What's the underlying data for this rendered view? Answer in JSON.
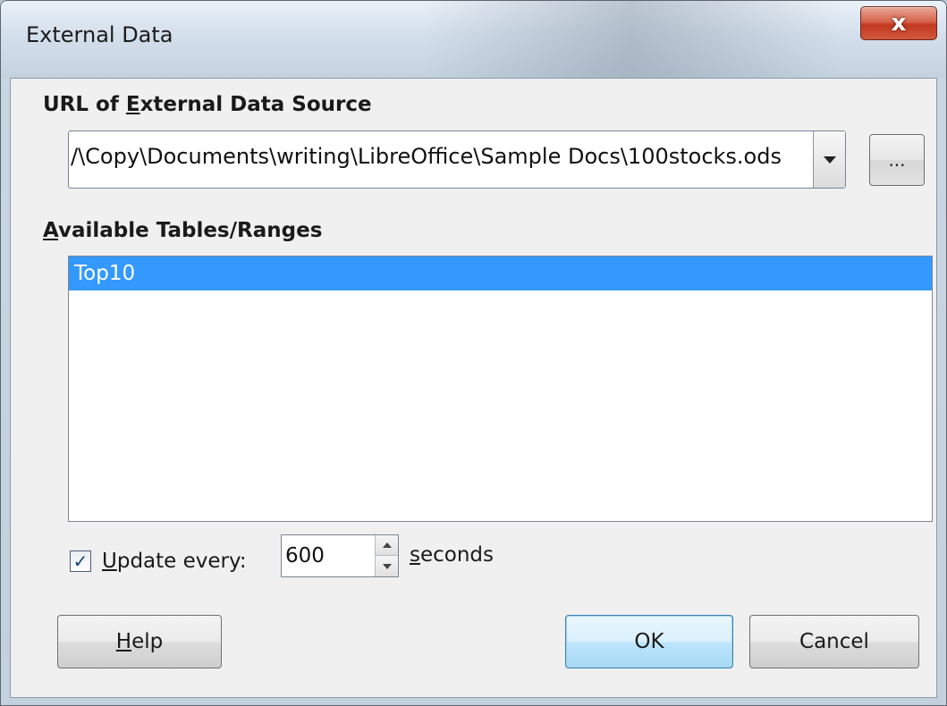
{
  "window": {
    "title": "External Data",
    "close_label": "x"
  },
  "url_section": {
    "label_pre": "URL of ",
    "label_accel": "E",
    "label_post": "xternal Data Source",
    "url_value": "/\\Copy\\Documents\\writing\\LibreOffice\\Sample Docs\\100stocks.ods",
    "browse_label": "..."
  },
  "tables_section": {
    "label_accel": "A",
    "label_post": "vailable Tables/Ranges",
    "items": [
      {
        "label": "Top10",
        "selected": true
      }
    ]
  },
  "update": {
    "checked": true,
    "check_mark": "✓",
    "label_accel": "U",
    "label_post": "pdate every:",
    "value": "600",
    "unit_accel": "s",
    "unit_post": "econds"
  },
  "buttons": {
    "help_accel": "H",
    "help_post": "elp",
    "ok_label": "OK",
    "cancel_label": "Cancel"
  },
  "colors": {
    "selection": "#3399ff",
    "close_button": "#c2391f",
    "default_button": "#bee6fd"
  }
}
